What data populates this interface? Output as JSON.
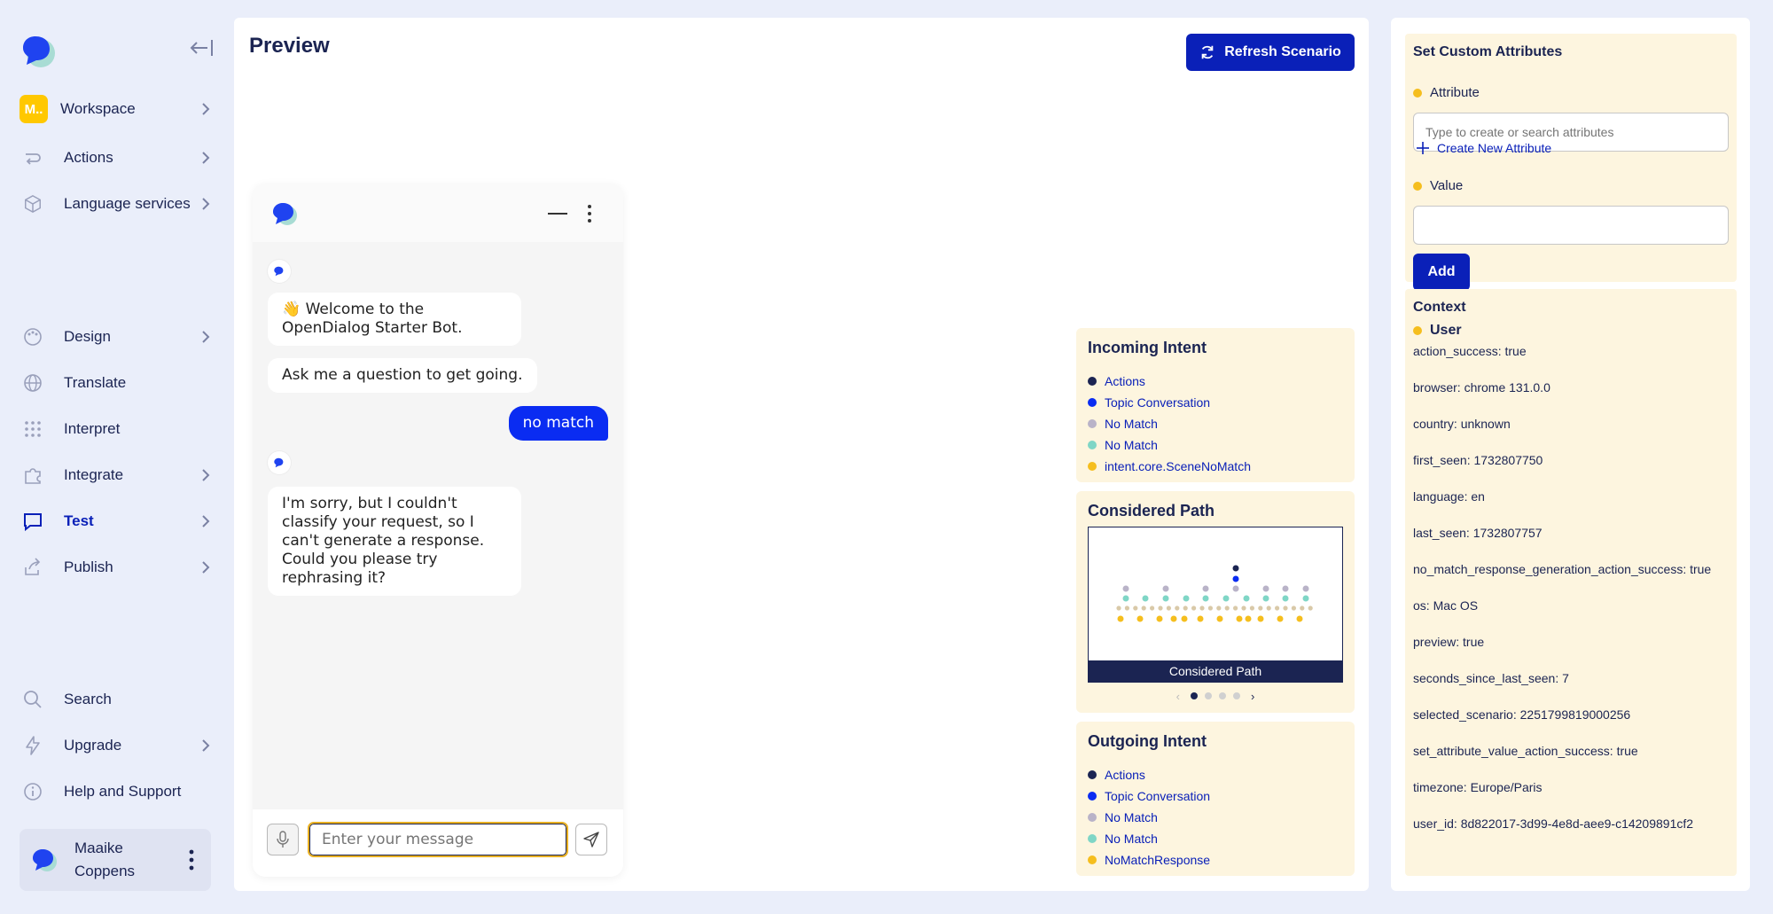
{
  "sidebar": {
    "workspace": {
      "badge": "M..",
      "label": "Workspace"
    },
    "items": [
      {
        "label": "Actions"
      },
      {
        "label": "Language services"
      },
      {
        "label": "Design"
      },
      {
        "label": "Translate"
      },
      {
        "label": "Interpret"
      },
      {
        "label": "Integrate"
      },
      {
        "label": "Test"
      },
      {
        "label": "Publish"
      },
      {
        "label": "Search"
      },
      {
        "label": "Upgrade"
      },
      {
        "label": "Help and Support"
      }
    ],
    "user": {
      "first": "Maaike",
      "last": "Coppens"
    }
  },
  "main": {
    "title": "Preview",
    "refresh_label": "Refresh Scenario"
  },
  "chat": {
    "messages": [
      {
        "from": "bot",
        "text": "👋 Welcome to the OpenDialog Starter Bot."
      },
      {
        "from": "bot",
        "text": "Ask me a question to get going."
      },
      {
        "from": "user",
        "text": "no match"
      },
      {
        "from": "bot",
        "text": "I'm sorry, but I couldn't classify your request, so I can't generate a response. Could you please try rephrasing it?"
      }
    ],
    "input_placeholder": "Enter your message"
  },
  "incoming_intent": {
    "title": "Incoming Intent",
    "items": [
      {
        "label": "Actions",
        "color": "#1b2452"
      },
      {
        "label": "Topic Conversation",
        "color": "#0a2cf2"
      },
      {
        "label": "No Match",
        "color": "#b9b3c8"
      },
      {
        "label": "No Match",
        "color": "#7fd6c6"
      },
      {
        "label": "intent.core.SceneNoMatch",
        "color": "#f5be1e"
      }
    ]
  },
  "considered_path": {
    "title": "Considered Path",
    "caption": "Considered Path",
    "page_prev": "‹",
    "page_next": "›"
  },
  "outgoing_intent": {
    "title": "Outgoing Intent",
    "items": [
      {
        "label": "Actions",
        "color": "#1b2452"
      },
      {
        "label": "Topic Conversation",
        "color": "#0a2cf2"
      },
      {
        "label": "No Match",
        "color": "#b9b3c8"
      },
      {
        "label": "No Match",
        "color": "#7fd6c6"
      },
      {
        "label": "NoMatchResponse",
        "color": "#f5be1e"
      }
    ]
  },
  "custom_attributes": {
    "title": "Set Custom Attributes",
    "attribute_label": "Attribute",
    "attribute_placeholder": "Type to create or search attributes",
    "create_label": "Create New Attribute",
    "value_label": "Value",
    "value_value": "",
    "add_label": "Add"
  },
  "context": {
    "title": "Context",
    "group": "User",
    "items": [
      "action_success: true",
      "browser: chrome 131.0.0",
      "country: unknown",
      "first_seen: 1732807750",
      "language: en",
      "last_seen: 1732807757",
      "no_match_response_generation_action_success: true",
      "os: Mac OS",
      "preview: true",
      "seconds_since_last_seen: 7",
      "selected_scenario: 2251799819000256",
      "set_attribute_value_action_success: true",
      "timezone: Europe/Paris",
      "user_id: 8d822017-3d99-4e8d-aee9-c14209891cf2"
    ]
  },
  "colors": {
    "brand": "#0a20b8",
    "navy": "#1b2452",
    "chat_user": "#0a2cf2",
    "panel": "#fdf5df",
    "accent_yellow": "#f5be1e"
  }
}
